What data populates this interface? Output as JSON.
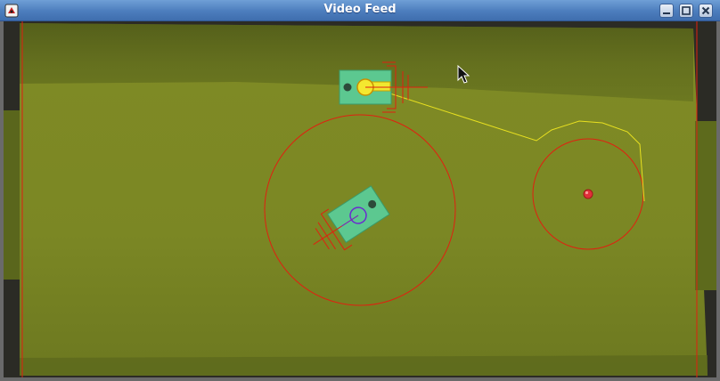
{
  "window": {
    "title": "Video Feed",
    "controls": [
      "minimize",
      "maximize",
      "close"
    ]
  },
  "colors": {
    "titlebar": "#4c7dbd",
    "field": "#7f8a25",
    "overlay_red": "#e02010",
    "overlay_yellow": "#e8e020",
    "robot_body": "#5cc890",
    "ball": "#e0303a"
  }
}
